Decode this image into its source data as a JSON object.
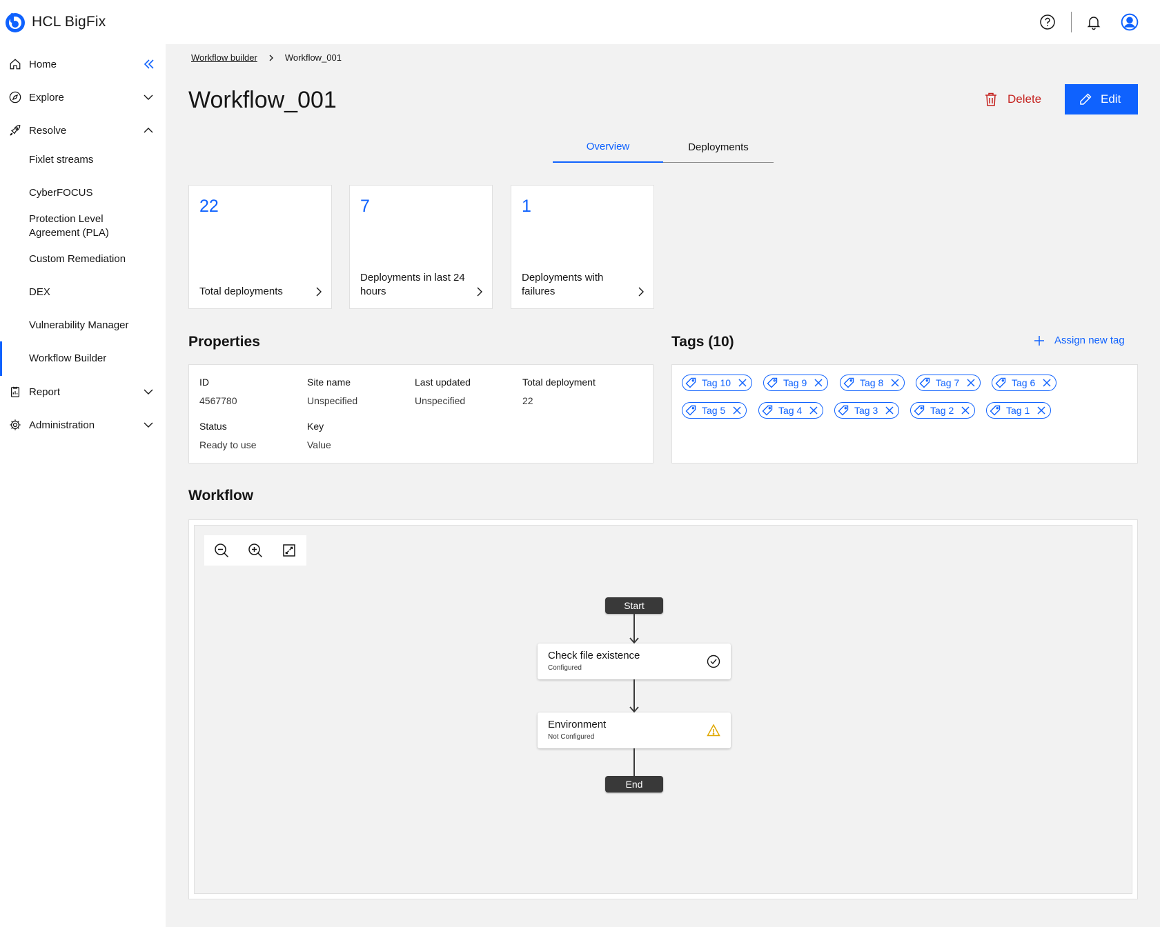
{
  "app": {
    "name": "HCL BigFix"
  },
  "colors": {
    "brand": "#0f62fe",
    "danger": "#c5221f",
    "warning": "#f1c21b",
    "pill": "#393939"
  },
  "sidebar": {
    "items": [
      {
        "label": "Home",
        "icon": "home-icon"
      },
      {
        "label": "Explore",
        "icon": "compass-icon"
      },
      {
        "label": "Resolve",
        "icon": "rocket-icon"
      },
      {
        "label": "Report",
        "icon": "report-icon"
      },
      {
        "label": "Administration",
        "icon": "gear-icon"
      }
    ],
    "resolve_children": [
      "Fixlet streams",
      "CyberFOCUS",
      "Protection Level Agreement (PLA)",
      "Custom Remediation",
      "DEX",
      "Vulnerability Manager",
      "Workflow Builder"
    ],
    "active": "Workflow Builder"
  },
  "breadcrumb": {
    "parent": "Workflow builder",
    "current": "Workflow_001"
  },
  "page": {
    "title": "Workflow_001",
    "delete_label": "Delete",
    "edit_label": "Edit"
  },
  "tabs": [
    {
      "label": "Overview",
      "active": true
    },
    {
      "label": "Deployments",
      "active": false
    }
  ],
  "stats": [
    {
      "value": "22",
      "label": "Total deployments"
    },
    {
      "value": "7",
      "label": "Deployments in last 24 hours"
    },
    {
      "value": "1",
      "label": "Deployments with failures"
    }
  ],
  "properties": {
    "title": "Properties",
    "fields": [
      {
        "key": "ID",
        "value": "4567780"
      },
      {
        "key": "Site name",
        "value": "Unspecified"
      },
      {
        "key": "Last updated",
        "value": "Unspecified"
      },
      {
        "key": "Total deployment",
        "value": "22"
      },
      {
        "key": "Status",
        "value": "Ready to use"
      },
      {
        "key": "Key",
        "value": "Value"
      }
    ]
  },
  "tags": {
    "title": "Tags (10)",
    "assign_label": "Assign new tag",
    "items": [
      "Tag 10",
      "Tag 9",
      "Tag 8",
      "Tag 7",
      "Tag 6",
      "Tag 5",
      "Tag 4",
      "Tag 3",
      "Tag 2",
      "Tag 1"
    ]
  },
  "workflow": {
    "title": "Workflow",
    "start_label": "Start",
    "end_label": "End",
    "steps": [
      {
        "title": "Check file existence",
        "status": "Configured",
        "status_icon": "checkmark-circle-icon"
      },
      {
        "title": "Environment",
        "status": "Not Configured",
        "status_icon": "warning-triangle-icon"
      }
    ]
  }
}
